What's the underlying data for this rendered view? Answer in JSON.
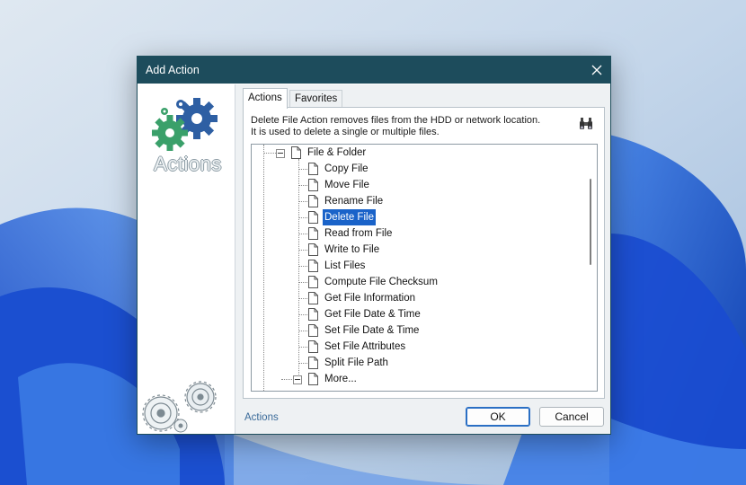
{
  "window": {
    "title": "Add Action"
  },
  "left_panel": {
    "logo_text": "Actions"
  },
  "tabs": [
    {
      "label": "Actions",
      "active": true
    },
    {
      "label": "Favorites",
      "active": false
    }
  ],
  "description": "Delete File Action removes files from the HDD or network location. It is used to delete a single or multiple files.",
  "tree": {
    "parent": "File & Folder",
    "items": [
      "Copy File",
      "Move File",
      "Rename File",
      "Delete File",
      "Read from File",
      "Write to File",
      "List Files",
      "Compute File Checksum",
      "Get File Information",
      "Get File Date & Time",
      "Set File Date & Time",
      "Set File Attributes",
      "Split File Path"
    ],
    "selected": "Delete File",
    "more": "More..."
  },
  "footer": {
    "link": "Actions",
    "ok_label": "OK",
    "cancel_label": "Cancel"
  },
  "colors": {
    "titlebar": "#1d4c5c",
    "selection": "#1a63c9",
    "gear_blue": "#2e5fa3",
    "gear_green": "#3aa06a"
  },
  "icons": [
    "close-icon",
    "binoculars-icon",
    "page-icon",
    "gear-icon"
  ]
}
